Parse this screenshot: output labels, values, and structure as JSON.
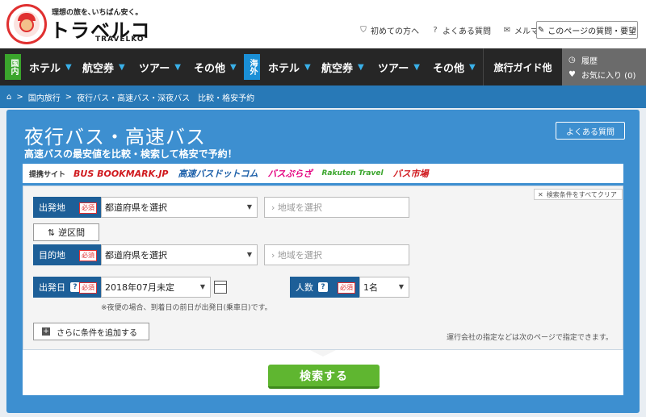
{
  "header": {
    "tagline": "理想の旅を､いちばん安く｡",
    "brand": "トラベルコ",
    "brand_sub": "TRAVELKO",
    "links": [
      "初めての方へ",
      "よくある質問",
      "メルマガ"
    ],
    "faq_button": "このページの質問・要望"
  },
  "nav": {
    "domestic_badge": "国内",
    "overseas_badge": "海外",
    "domestic_items": [
      "ホテル",
      "航空券",
      "ツアー",
      "その他"
    ],
    "overseas_items": [
      "ホテル",
      "航空券",
      "ツアー",
      "その他"
    ],
    "guide": "旅行ガイド他",
    "history": "履歴",
    "favorites": "お気に入り (0)"
  },
  "breadcrumb": [
    "国内旅行",
    ">",
    "夜行バス・高速バス・深夜バス　比較・格安予約"
  ],
  "main": {
    "title": "夜行バス・高速バス",
    "subtitle": "高速バスの最安値を比較・検索して格安で予約！",
    "faq": "よくある質問",
    "partners_label": "提携サイト",
    "partners": [
      "BUS BOOKMARK.JP",
      "高速バスドットコム",
      "バスぷらざ",
      "Rakuten Travel",
      "バス市場"
    ]
  },
  "form": {
    "clear": "検索条件をすべてクリア",
    "departure_label": "出発地",
    "required": "必須",
    "prefecture_placeholder": "都道府県を選択",
    "area_placeholder": "› 地域を選択",
    "swap": "逆区間",
    "destination_label": "目的地",
    "date_label": "出発日",
    "date_value": "2018年07月未定",
    "people_label": "人数",
    "people_value": "1名",
    "note": "※夜便の場合、到着日の前日が出発日(乗車日)です。",
    "add_condition": "さらに条件を追加する",
    "operator_note": "運行会社の指定などは次のページで指定できます。",
    "search_button": "検索する"
  },
  "colors": {
    "nav_bg": "#262626",
    "breadcrumb_bg": "#2879b7",
    "panel_bg": "#3d8fd0",
    "label_bg": "#1d5f98",
    "search_button": "#5fb630"
  }
}
